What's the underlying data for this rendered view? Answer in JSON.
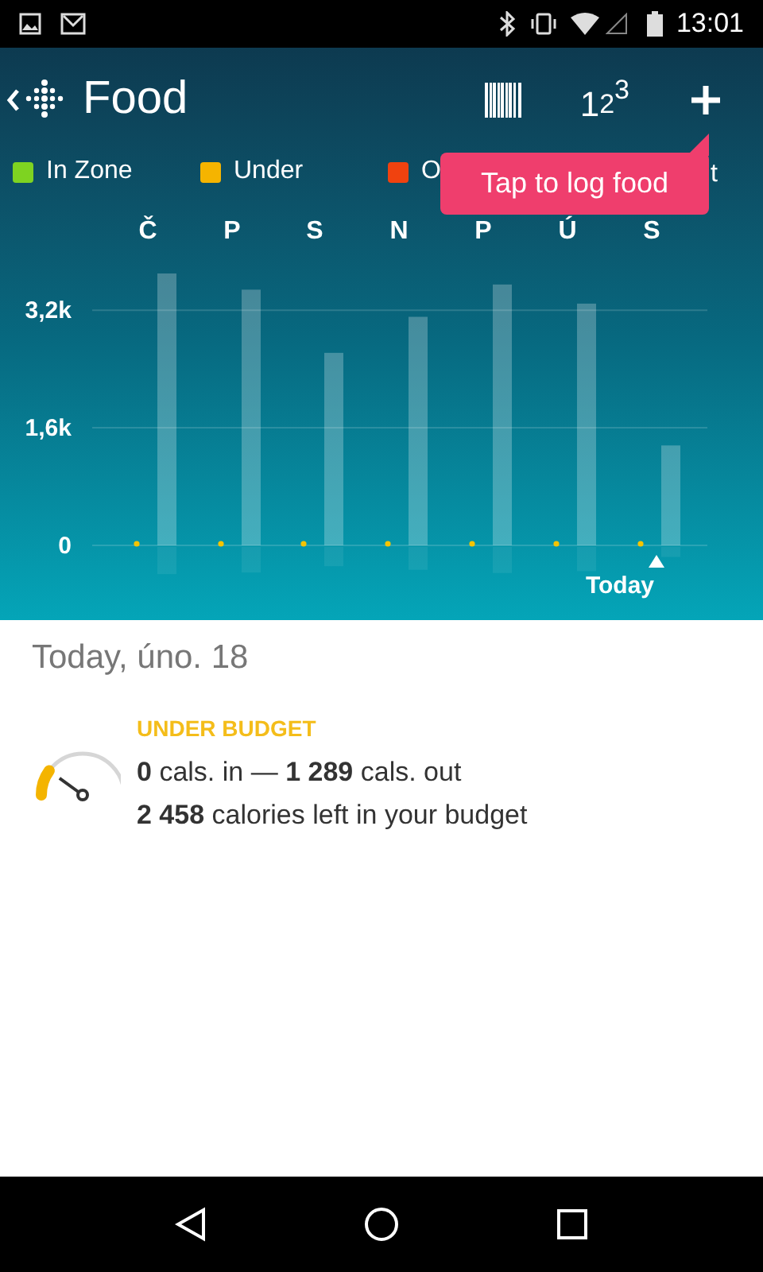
{
  "status_bar": {
    "time": "13:01"
  },
  "app_bar": {
    "title": "Food",
    "actions": [
      {
        "kind": "barcode"
      },
      {
        "kind": "number",
        "label": "1",
        "sup": "2",
        "sup2": "3"
      },
      {
        "kind": "add"
      }
    ]
  },
  "legend": [
    {
      "label": "In Zone",
      "color": "#7ed321"
    },
    {
      "label": "Under",
      "color": "#f5b400"
    },
    {
      "label": "O",
      "color": "#f0420f"
    }
  ],
  "legend_tail": "t",
  "tooltip": {
    "text": "Tap to log food"
  },
  "chart_data": {
    "type": "bar",
    "categories": [
      "Č",
      "P",
      "S",
      "N",
      "P",
      "Ú",
      "S"
    ],
    "values": [
      3700,
      3480,
      2620,
      3110,
      3550,
      3290,
      1360
    ],
    "ylim": [
      0,
      3700
    ],
    "yticks": [
      {
        "value": 0,
        "label": "0"
      },
      {
        "value": 1600,
        "label": "1,6k"
      },
      {
        "value": 3200,
        "label": "3,2k"
      }
    ],
    "annotations": [
      "Today"
    ]
  },
  "day": {
    "title": "Today, úno. 18",
    "status": "UNDER BUDGET",
    "in": "0",
    "in_label": "cals. in —",
    "out": "1 289",
    "out_label": "cals. out",
    "left": "2 458",
    "left_label": "calories left in your budget"
  }
}
